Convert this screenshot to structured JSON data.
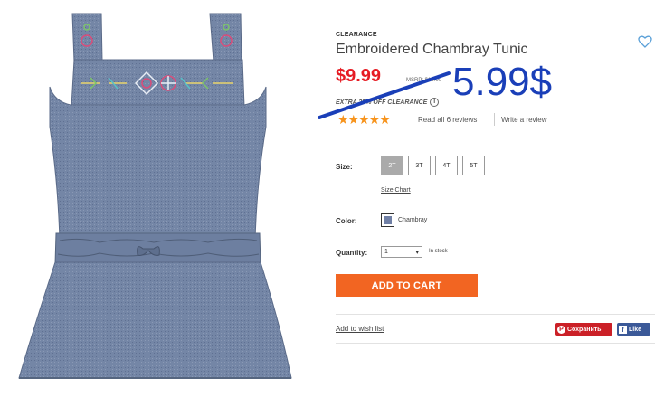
{
  "product": {
    "badge": "CLEARANCE",
    "title": "Embroidered Chambray Tunic",
    "price": "$9.99",
    "msrp": "MSRP: $16.00",
    "promo": "EXTRA 25% OFF CLEARANCE",
    "handwritten_price": "5.99$",
    "rating_stars": "★★★★★",
    "rating": 5,
    "reviews_link": "Read all 6 reviews",
    "write_review": "Write a review"
  },
  "size": {
    "label": "Size:",
    "options": [
      "2T",
      "3T",
      "4T",
      "5T"
    ],
    "selected": "2T",
    "chart_link": "Size Chart"
  },
  "color": {
    "label": "Color:",
    "name": "Chambray",
    "swatch": "#6f7fa5"
  },
  "quantity": {
    "label": "Quantity:",
    "value": "1",
    "stock": "In stock"
  },
  "actions": {
    "add_to_cart": "ADD TO CART",
    "wishlist": "Add to wish list",
    "pin": "Сохранить",
    "like": "Like"
  },
  "colors": {
    "accent": "#f26522",
    "price_red": "#e61c24",
    "annotation_blue": "#1a3fb8",
    "star_orange": "#f7941d",
    "pinterest": "#cb2027",
    "facebook": "#3b5998"
  }
}
